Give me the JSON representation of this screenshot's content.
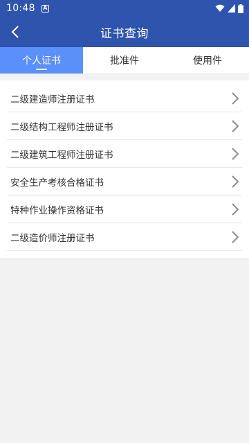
{
  "status_bar": {
    "time": "10:48",
    "notification_icon": "A"
  },
  "header": {
    "title": "证书查询"
  },
  "tabs": [
    {
      "label": "个人证书",
      "active": true
    },
    {
      "label": "批准件",
      "active": false
    },
    {
      "label": "使用件",
      "active": false
    }
  ],
  "list": [
    {
      "label": "二级建造师注册证书"
    },
    {
      "label": "二级结构工程师注册证书"
    },
    {
      "label": "二级建筑工程师注册证书"
    },
    {
      "label": "安全生产考核合格证书"
    },
    {
      "label": "特种作业操作资格证书"
    },
    {
      "label": "二级造价师注册证书"
    }
  ],
  "colors": {
    "primary": "#2e54ad",
    "active_tab": "#5b8ff9",
    "background": "#f2f2f2"
  },
  "icons": {
    "back": "back-arrow-icon",
    "chevron": "chevron-right-icon",
    "wifi": "wifi-icon",
    "signal": "signal-icon",
    "battery": "battery-icon"
  }
}
